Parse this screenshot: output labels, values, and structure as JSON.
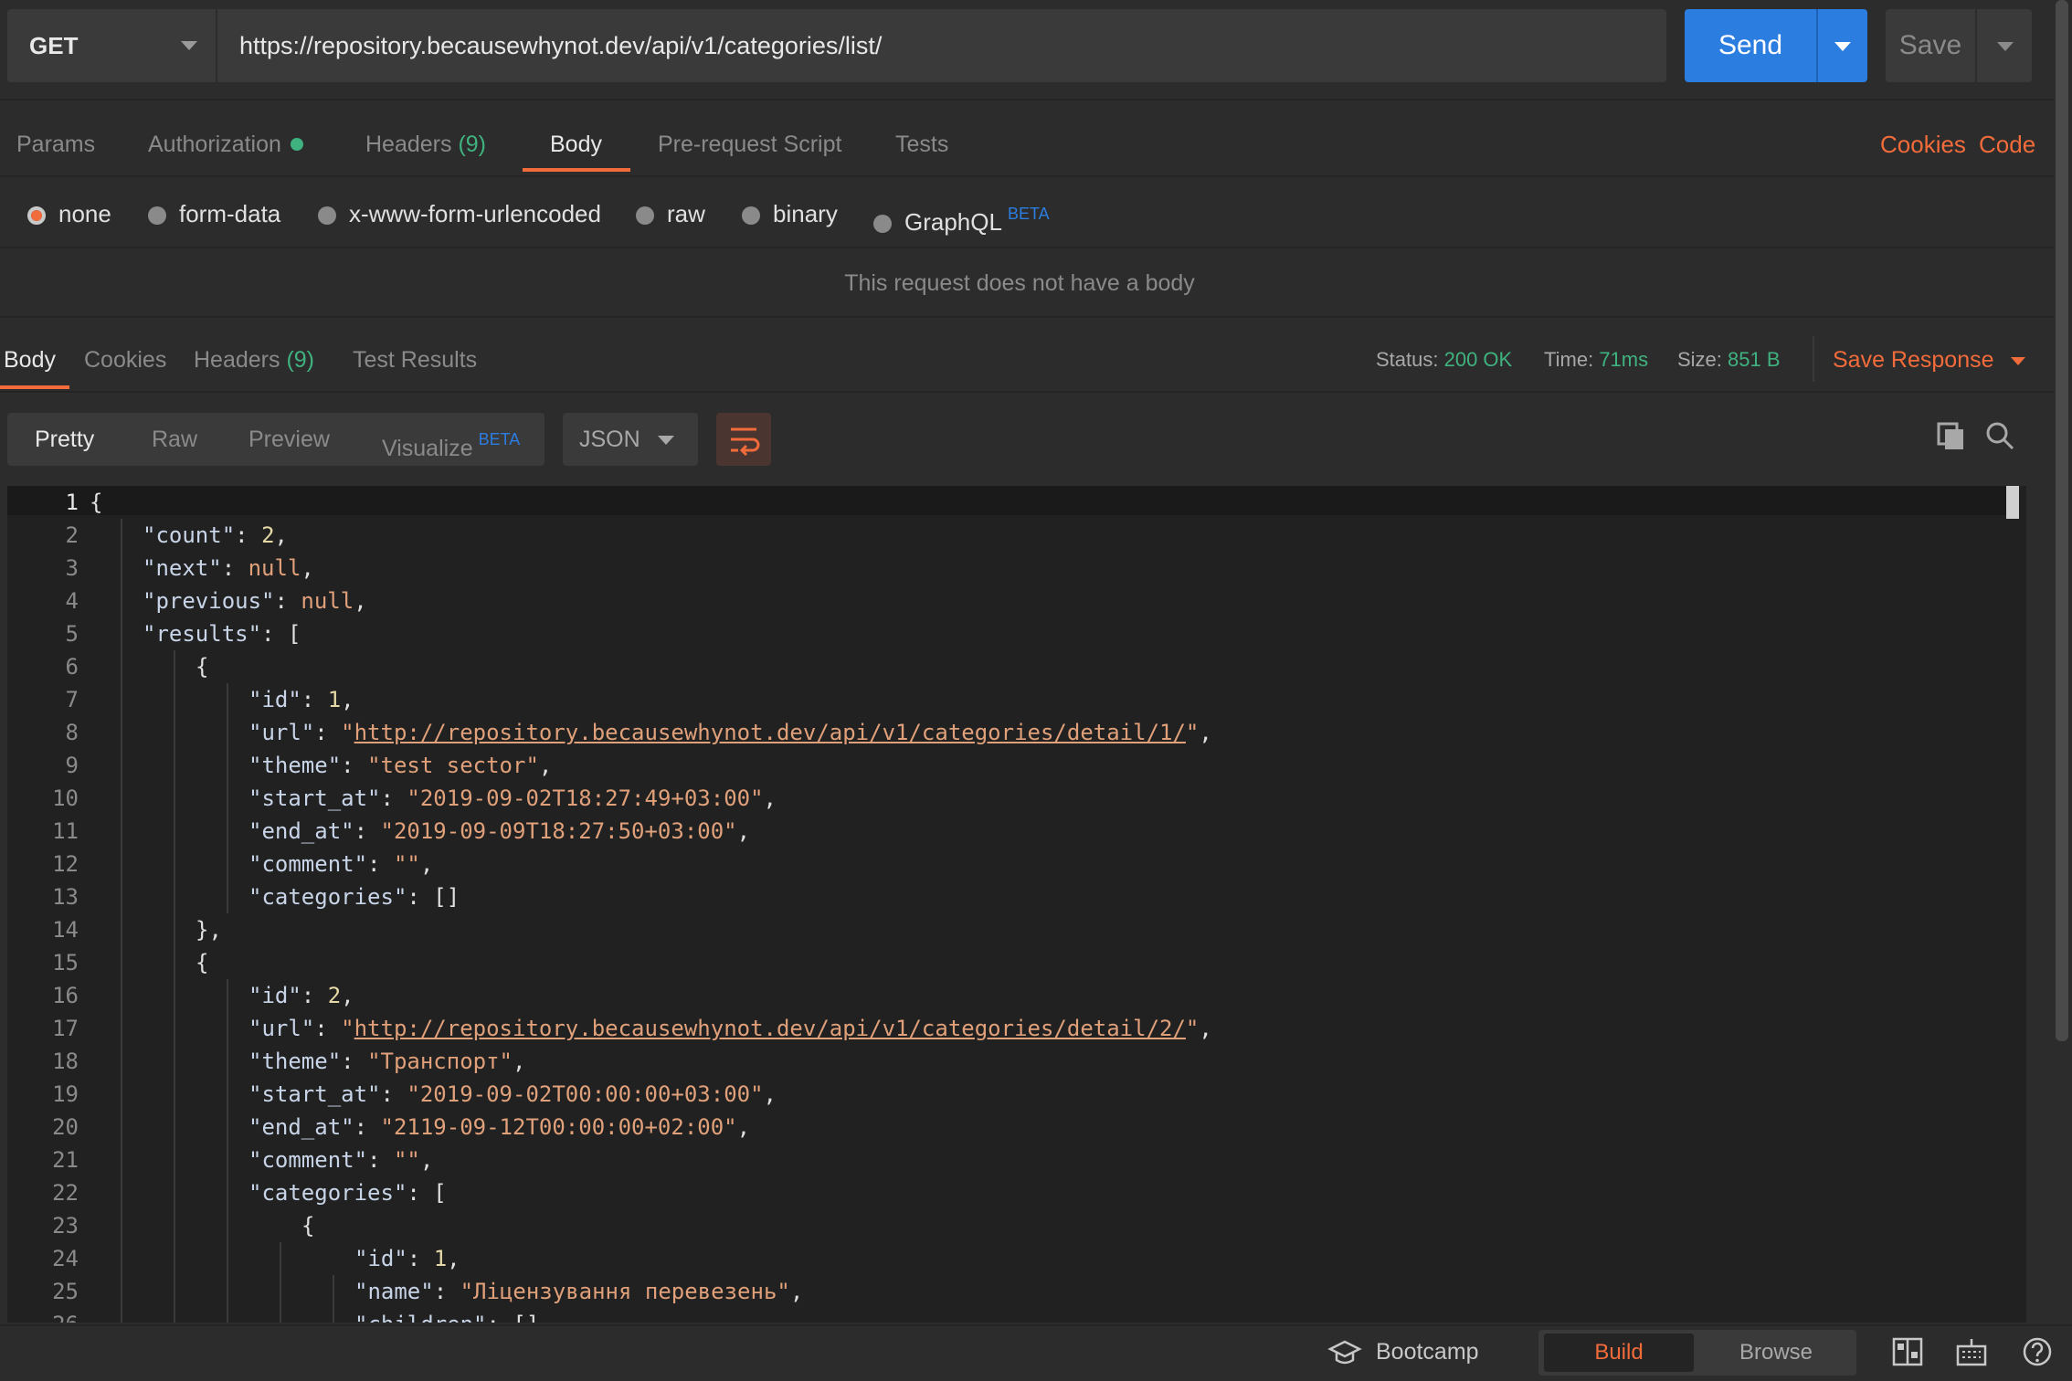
{
  "request": {
    "method": "GET",
    "url": "https://repository.becausewhynot.dev/api/v1/categories/list/",
    "send_label": "Send",
    "save_label": "Save"
  },
  "request_tabs": [
    {
      "label": "Params"
    },
    {
      "label": "Authorization"
    },
    {
      "label": "Headers",
      "count": "(9)"
    },
    {
      "label": "Body"
    },
    {
      "label": "Pre-request Script"
    },
    {
      "label": "Tests"
    }
  ],
  "request_links": {
    "cookies": "Cookies",
    "code": "Code"
  },
  "body_modes": [
    {
      "label": "none"
    },
    {
      "label": "form-data"
    },
    {
      "label": "x-www-form-urlencoded"
    },
    {
      "label": "raw"
    },
    {
      "label": "binary"
    },
    {
      "label": "GraphQL",
      "badge": "BETA"
    }
  ],
  "no_body_message": "This request does not have a body",
  "response_tabs": [
    {
      "label": "Body"
    },
    {
      "label": "Cookies"
    },
    {
      "label": "Headers",
      "count": "(9)"
    },
    {
      "label": "Test Results"
    }
  ],
  "response_status": {
    "status_label": "Status:",
    "status_value": "200 OK",
    "time_label": "Time:",
    "time_value": "71ms",
    "size_label": "Size:",
    "size_value": "851 B",
    "save_response": "Save Response"
  },
  "view_modes": [
    {
      "label": "Pretty"
    },
    {
      "label": "Raw"
    },
    {
      "label": "Preview"
    },
    {
      "label": "Visualize",
      "badge": "BETA"
    }
  ],
  "format": "JSON",
  "code_lines": [
    "{",
    "\"count\": 2,",
    "\"next\": null,",
    "\"previous\": null,",
    "\"results\": [",
    "{",
    "\"id\": 1,",
    "\"url\": \"http://repository.becausewhynot.dev/api/v1/categories/detail/1/\",",
    "\"theme\": \"test sector\",",
    "\"start_at\": \"2019-09-02T18:27:49+03:00\",",
    "\"end_at\": \"2019-09-09T18:27:50+03:00\",",
    "\"comment\": \"\",",
    "\"categories\": []",
    "},",
    "{",
    "\"id\": 2,",
    "\"url\": \"http://repository.becausewhynot.dev/api/v1/categories/detail/2/\",",
    "\"theme\": \"Транспорт\",",
    "\"start_at\": \"2019-09-02T00:00:00+03:00\",",
    "\"end_at\": \"2119-09-12T00:00:00+02:00\",",
    "\"comment\": \"\",",
    "\"categories\": [",
    "{",
    "\"id\": 1,",
    "\"name\": \"Ліцензування перевезень\",",
    "\"children\": []"
  ],
  "footer": {
    "bootcamp": "Bootcamp",
    "build": "Build",
    "browse": "Browse"
  },
  "colors": {
    "accent": "#f26b3a",
    "primary": "#2b7de0",
    "success": "#3fb27f"
  }
}
